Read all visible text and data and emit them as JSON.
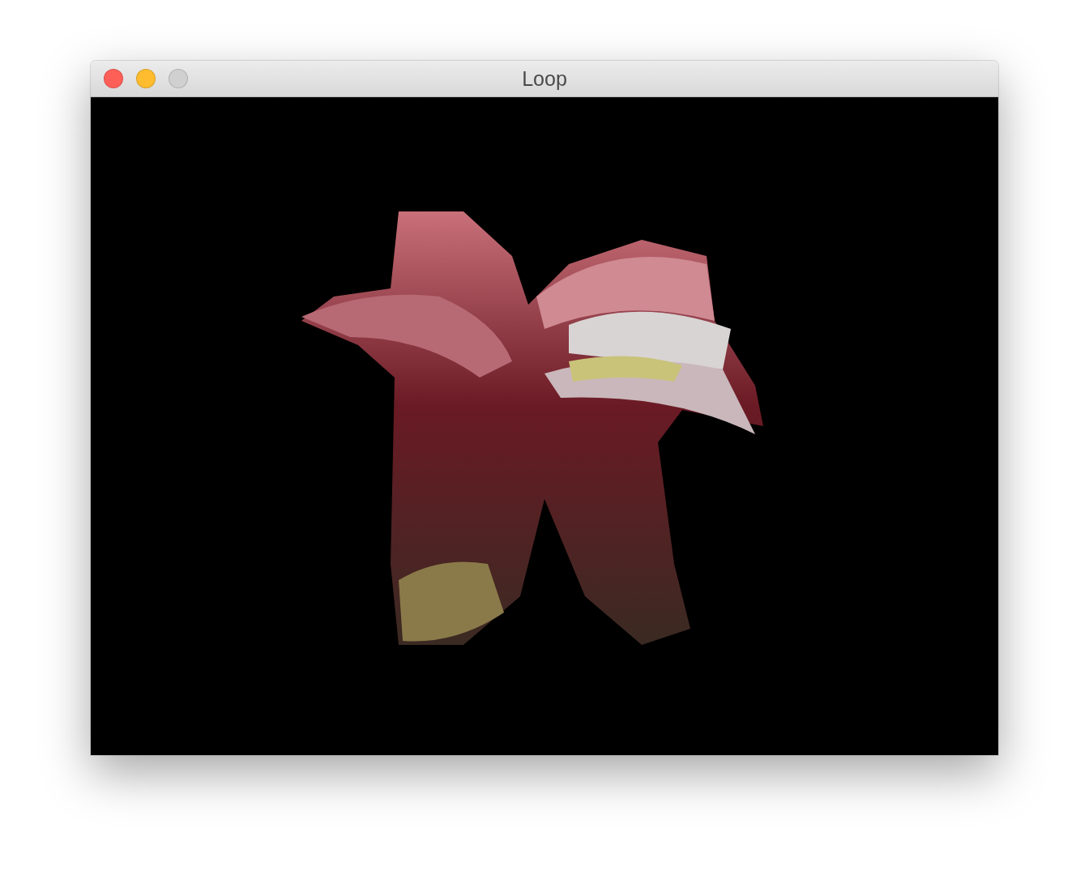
{
  "window": {
    "title": "Loop",
    "buttons": [
      {
        "kind": "close",
        "disabled": false
      },
      {
        "kind": "minimize",
        "disabled": false
      },
      {
        "kind": "zoom",
        "disabled": true
      }
    ]
  }
}
